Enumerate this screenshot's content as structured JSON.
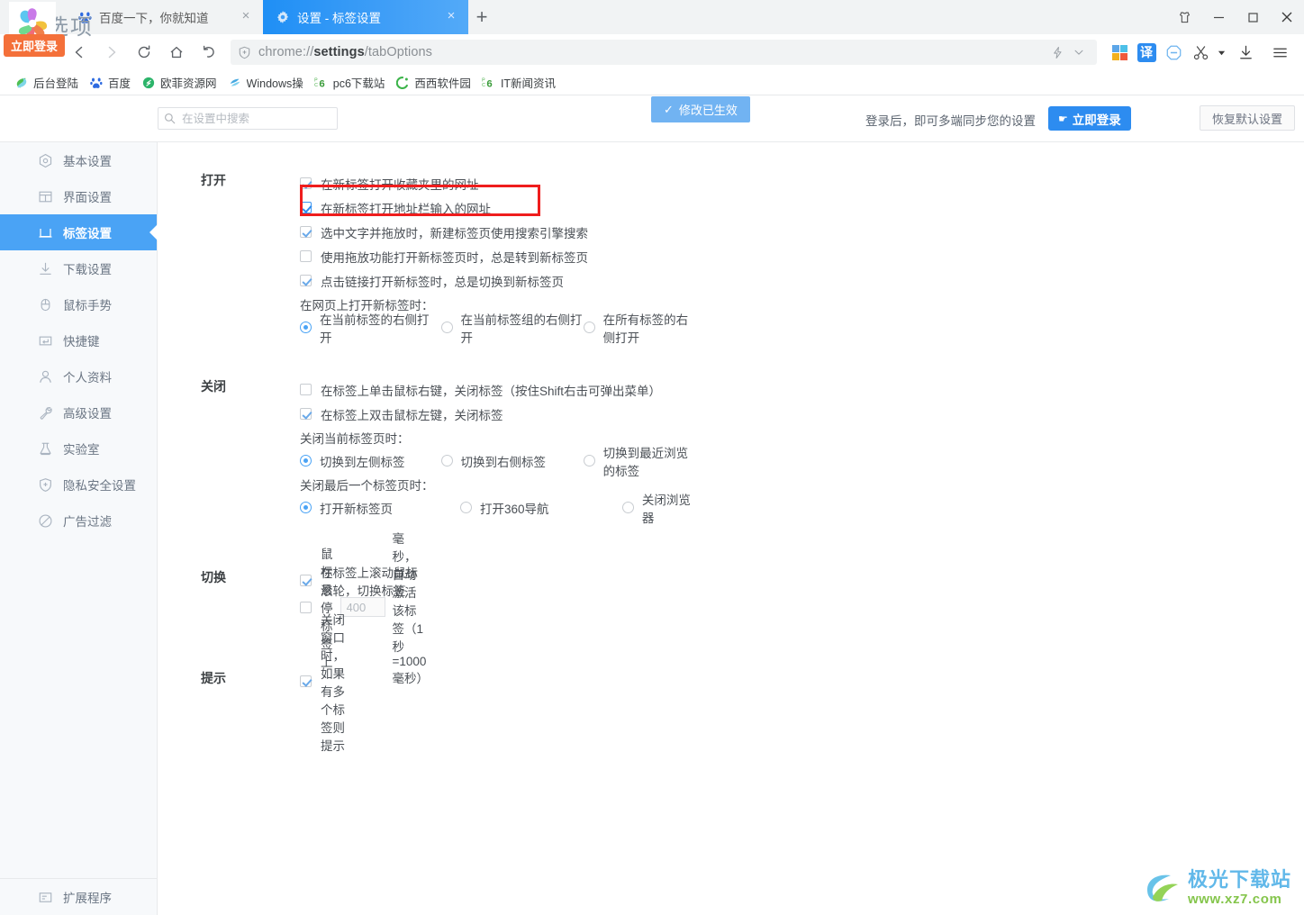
{
  "window": {
    "controls": [
      {
        "name": "skin-button",
        "glyph": "skin"
      },
      {
        "name": "minimize-button",
        "glyph": "minimize"
      },
      {
        "name": "maximize-button",
        "glyph": "maximize"
      },
      {
        "name": "close-button",
        "glyph": "close"
      }
    ]
  },
  "browser": {
    "login_badge": "立即登录",
    "tabs": [
      {
        "title": "百度一下，你就知道",
        "favicon": "baidu-icon",
        "active": false
      },
      {
        "title": "设置 - 标签设置",
        "favicon": "gear-icon",
        "active": true
      }
    ],
    "new_tab_label": "+",
    "nav": {
      "back": "‹",
      "forward": "›",
      "reload": "⟳",
      "home": "⌂",
      "history": "↺"
    },
    "omnibox": {
      "url_prefix": "chrome://",
      "url_bold": "settings",
      "url_suffix": "/tabOptions",
      "full_url": "chrome://settings/tabOptions",
      "shield_icon": "shield-plus-icon"
    },
    "toolbar_icons": [
      {
        "name": "lightning-icon",
        "label": "⚡"
      },
      {
        "name": "chevron-down-icon",
        "label": "⌄"
      },
      {
        "name": "apps-grid-icon",
        "label": "apps"
      },
      {
        "name": "translate-icon",
        "label": "译"
      },
      {
        "name": "adblock-icon",
        "label": "⊖"
      },
      {
        "name": "screenshot-scissors-icon",
        "label": "✂"
      },
      {
        "name": "scissors-dropdown-icon",
        "label": "▾"
      },
      {
        "name": "download-icon",
        "label": "⤓"
      },
      {
        "name": "menu-icon",
        "label": "☰"
      }
    ],
    "bookmarks": [
      {
        "label": "后台登陆",
        "icon": "green-swirl-icon"
      },
      {
        "label": "百度",
        "icon": "baidu-icon"
      },
      {
        "label": "欧菲资源网",
        "icon": "green-circle-icon"
      },
      {
        "label": "Windows操",
        "icon": "windows-blue-icon"
      },
      {
        "label": "pc6下载站",
        "icon": "pc6-icon"
      },
      {
        "label": "西西软件园",
        "icon": "green-c-icon"
      },
      {
        "label": "IT新闻资讯",
        "icon": "pc6-icon"
      }
    ]
  },
  "settings": {
    "page_title": "选项",
    "search": {
      "placeholder": "在设置中搜索",
      "value": "",
      "icon": "search-icon"
    },
    "saved_badge": {
      "check": "✓",
      "text": "修改已生效"
    },
    "login_hint": "登录后，即可多端同步您的设置",
    "login_button": "立即登录",
    "reset_button": "恢复默认设置",
    "sidebar": [
      {
        "label": "基本设置",
        "icon": "target-icon",
        "active": false
      },
      {
        "label": "界面设置",
        "icon": "window-icon",
        "active": false
      },
      {
        "label": "标签设置",
        "icon": "tab-icon",
        "active": true
      },
      {
        "label": "下载设置",
        "icon": "download-icon",
        "active": false
      },
      {
        "label": "鼠标手势",
        "icon": "mouse-icon",
        "active": false
      },
      {
        "label": "快捷键",
        "icon": "keyboard-icon",
        "active": false
      },
      {
        "label": "个人资料",
        "icon": "person-icon",
        "active": false
      },
      {
        "label": "高级设置",
        "icon": "wrench-icon",
        "active": false
      },
      {
        "label": "实验室",
        "icon": "flask-icon",
        "active": false
      },
      {
        "label": "隐私安全设置",
        "icon": "shield-plus-icon",
        "active": false
      },
      {
        "label": "广告过滤",
        "icon": "ban-icon",
        "active": false
      }
    ],
    "sidebar_bottom": {
      "label": "扩展程序",
      "icon": "extension-icon"
    },
    "sections": [
      {
        "title": "打开",
        "checkboxes": [
          {
            "label": "在新标签打开收藏夹里的网址",
            "checked": true,
            "highlighted": false
          },
          {
            "label": "在新标签打开地址栏输入的网址",
            "checked": true,
            "highlighted": true
          },
          {
            "label": "选中文字并拖放时，新建标签页使用搜索引擎搜索",
            "checked": true,
            "highlighted": false
          },
          {
            "label": "使用拖放功能打开新标签页时，总是转到新标签页",
            "checked": false,
            "highlighted": false
          },
          {
            "label": "点击链接打开新标签时，总是切换到新标签页",
            "checked": true,
            "highlighted": false
          }
        ],
        "radio_groups": [
          {
            "label": "在网页上打开新标签时：",
            "options": [
              {
                "label": "在当前标签的右侧打开",
                "selected": true
              },
              {
                "label": "在当前标签组的右侧打开",
                "selected": false
              },
              {
                "label": "在所有标签的右侧打开",
                "selected": false
              }
            ]
          }
        ]
      },
      {
        "title": "关闭",
        "checkboxes": [
          {
            "label": "在标签上单击鼠标右键，关闭标签（按住Shift右击可弹出菜单）",
            "checked": false,
            "highlighted": false
          },
          {
            "label": "在标签上双击鼠标左键，关闭标签",
            "checked": true,
            "highlighted": false
          }
        ],
        "radio_groups": [
          {
            "label": "关闭当前标签页时：",
            "options": [
              {
                "label": "切换到左侧标签",
                "selected": true
              },
              {
                "label": "切换到右侧标签",
                "selected": false
              },
              {
                "label": "切换到最近浏览的标签",
                "selected": false
              }
            ]
          },
          {
            "label": "关闭最后一个标签页时：",
            "options": [
              {
                "label": "打开新标签页",
                "selected": true
              },
              {
                "label": "打开360导航",
                "selected": false
              },
              {
                "label": "关闭浏览器",
                "selected": false
              }
            ]
          }
        ]
      },
      {
        "title": "切换",
        "checkboxes": [
          {
            "label": "在标签上滚动鼠标滚轮，切换标签",
            "checked": true,
            "highlighted": false
          }
        ],
        "hover_row": {
          "checked": false,
          "prefix": "鼠标悬停标签上",
          "value": "400",
          "suffix": "毫秒，自动激活该标签（1秒=1000毫秒）"
        }
      },
      {
        "title": "提示",
        "checkboxes": [
          {
            "label": "关闭窗口时，如果有多个标签则提示",
            "checked": true,
            "highlighted": false
          }
        ]
      }
    ]
  },
  "watermark": {
    "cn": "极光下载站",
    "en": "www.xz7.com"
  },
  "colors": {
    "accent": "#4aa3f5",
    "tab_active": "#2f97f6",
    "highlight": "#ef1d1d",
    "login": "#2d8cf0",
    "saved": "#71b3f2"
  }
}
